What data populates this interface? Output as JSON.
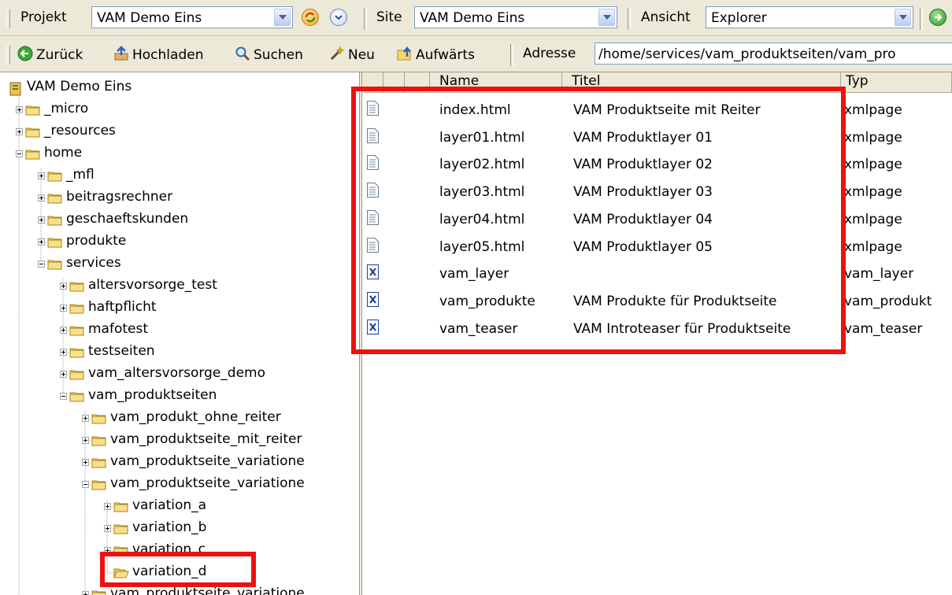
{
  "toolbar1": {
    "project_label": "Projekt",
    "project_value": "VAM Demo Eins",
    "site_label": "Site",
    "site_value": "VAM Demo Eins",
    "view_label": "Ansicht",
    "view_value": "Explorer"
  },
  "toolbar2": {
    "back_label": "Zurück",
    "upload_label": "Hochladen",
    "search_label": "Suchen",
    "new_label": "Neu",
    "up_label": "Aufwärts",
    "address_label": "Adresse",
    "address_value": "/home/services/vam_produktseiten/vam_pro"
  },
  "tree": {
    "root": "VAM Demo Eins",
    "nodes": [
      "_micro",
      "_resources",
      "home",
      "_mfl",
      "beitragsrechner",
      "geschaeftskunden",
      "produkte",
      "services",
      "altersvorsorge_test",
      "haftpflicht",
      "mafotest",
      "testseiten",
      "vam_altersvorsorge_demo",
      "vam_produktseiten",
      "vam_produkt_ohne_reiter",
      "vam_produktseite_mit_reiter",
      "vam_produktseite_variatione",
      "vam_produktseite_variatione",
      "variation_a",
      "variation_b",
      "variation_c",
      "variation_d",
      "vam_produktseite_variatione"
    ]
  },
  "list": {
    "headers": [
      "Name",
      "Titel",
      "Typ"
    ],
    "rows": [
      {
        "name": "index.html",
        "title": "VAM Produktseite mit Reiter",
        "type": "xmlpage",
        "icon": "page-icon"
      },
      {
        "name": "layer01.html",
        "title": "VAM Produktlayer 01",
        "type": "xmlpage",
        "icon": "page-icon"
      },
      {
        "name": "layer02.html",
        "title": "VAM Produktlayer 02",
        "type": "xmlpage",
        "icon": "page-icon"
      },
      {
        "name": "layer03.html",
        "title": "VAM Produktlayer 03",
        "type": "xmlpage",
        "icon": "page-icon"
      },
      {
        "name": "layer04.html",
        "title": "VAM Produktlayer 04",
        "type": "xmlpage",
        "icon": "page-icon"
      },
      {
        "name": "layer05.html",
        "title": "VAM Produktlayer 05",
        "type": "xmlpage",
        "icon": "page-icon"
      },
      {
        "name": "vam_layer",
        "title": "",
        "type": "vam_layer",
        "icon": "xml-icon"
      },
      {
        "name": "vam_produkte",
        "title": "VAM Produkte für Produktseite",
        "type": "vam_produkt",
        "icon": "xml-icon"
      },
      {
        "name": "vam_teaser",
        "title": "VAM Introteaser für Produktseite",
        "type": "vam_teaser",
        "icon": "xml-icon"
      }
    ]
  },
  "colors": {
    "highlight": "#ee1111",
    "toolbar": "#ece9d8",
    "folder": "#f5d76e"
  }
}
